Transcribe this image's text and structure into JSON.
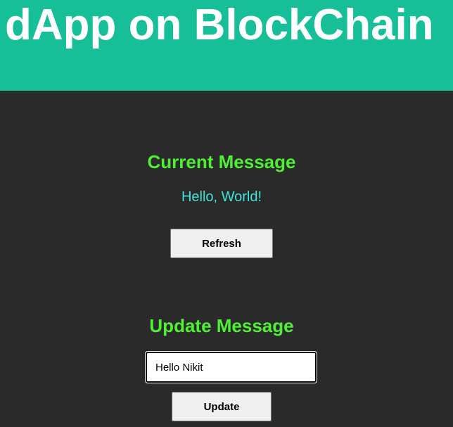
{
  "header": {
    "title": "dApp on BlockChain"
  },
  "current_section": {
    "title": "Current Message",
    "message": "Hello, World!",
    "refresh_label": "Refresh"
  },
  "update_section": {
    "title": "Update Message",
    "input_value": "Hello Nikit",
    "update_label": "Update"
  },
  "colors": {
    "header_bg": "#17bf99",
    "page_bg": "#2a2a2a",
    "heading": "#4ff034",
    "message": "#3de4d8",
    "button_bg": "#efefef"
  }
}
